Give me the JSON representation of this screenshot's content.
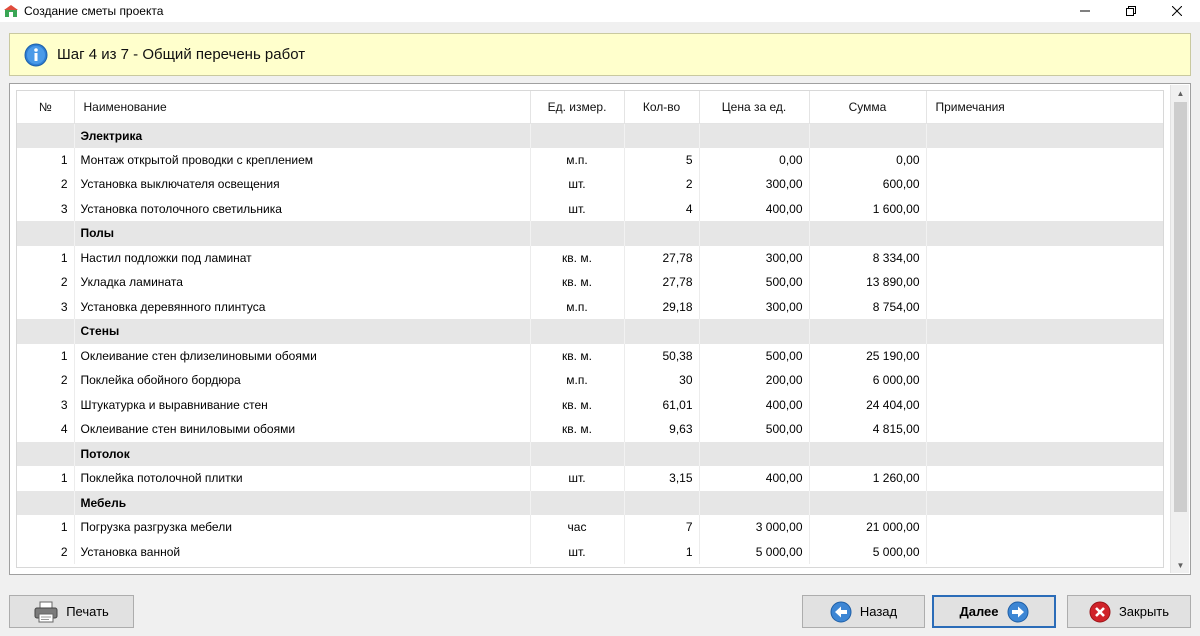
{
  "window": {
    "title": "Создание сметы проекта"
  },
  "step": {
    "text": "Шаг 4 из 7 - Общий перечень работ"
  },
  "table": {
    "columns": [
      "№",
      "Наименование",
      "Ед. измер.",
      "Кол-во",
      "Цена за ед.",
      "Сумма",
      "Примечания"
    ],
    "rows": [
      {
        "type": "category",
        "name": "Электрика"
      },
      {
        "type": "item",
        "no": "1",
        "name": "Монтаж открытой проводки с креплением",
        "unit": "м.п.",
        "qty": "5",
        "price": "0,00",
        "sum": "0,00",
        "note": ""
      },
      {
        "type": "item",
        "no": "2",
        "name": "Установка выключателя освещения",
        "unit": "шт.",
        "qty": "2",
        "price": "300,00",
        "sum": "600,00",
        "note": ""
      },
      {
        "type": "item",
        "no": "3",
        "name": "Установка потолочного светильника",
        "unit": "шт.",
        "qty": "4",
        "price": "400,00",
        "sum": "1 600,00",
        "note": ""
      },
      {
        "type": "category",
        "name": "Полы"
      },
      {
        "type": "item",
        "no": "1",
        "name": "Настил подложки под ламинат",
        "unit": "кв. м.",
        "qty": "27,78",
        "price": "300,00",
        "sum": "8 334,00",
        "note": ""
      },
      {
        "type": "item",
        "no": "2",
        "name": "Укладка ламината",
        "unit": "кв. м.",
        "qty": "27,78",
        "price": "500,00",
        "sum": "13 890,00",
        "note": ""
      },
      {
        "type": "item",
        "no": "3",
        "name": "Установка деревянного плинтуса",
        "unit": "м.п.",
        "qty": "29,18",
        "price": "300,00",
        "sum": "8 754,00",
        "note": ""
      },
      {
        "type": "category",
        "name": "Стены"
      },
      {
        "type": "item",
        "no": "1",
        "name": "Оклеивание стен флизелиновыми обоями",
        "unit": "кв. м.",
        "qty": "50,38",
        "price": "500,00",
        "sum": "25 190,00",
        "note": ""
      },
      {
        "type": "item",
        "no": "2",
        "name": "Поклейка обойного бордюра",
        "unit": "м.п.",
        "qty": "30",
        "price": "200,00",
        "sum": "6 000,00",
        "note": ""
      },
      {
        "type": "item",
        "no": "3",
        "name": "Штукатурка и выравнивание стен",
        "unit": "кв. м.",
        "qty": "61,01",
        "price": "400,00",
        "sum": "24 404,00",
        "note": ""
      },
      {
        "type": "item",
        "no": "4",
        "name": "Оклеивание стен виниловыми обоями",
        "unit": "кв. м.",
        "qty": "9,63",
        "price": "500,00",
        "sum": "4 815,00",
        "note": ""
      },
      {
        "type": "category",
        "name": "Потолок"
      },
      {
        "type": "item",
        "no": "1",
        "name": "Поклейка потолочной плитки",
        "unit": "шт.",
        "qty": "3,15",
        "price": "400,00",
        "sum": "1 260,00",
        "note": ""
      },
      {
        "type": "category",
        "name": "Мебель"
      },
      {
        "type": "item",
        "no": "1",
        "name": "Погрузка разгрузка мебели",
        "unit": "час",
        "qty": "7",
        "price": "3 000,00",
        "sum": "21 000,00",
        "note": ""
      },
      {
        "type": "item",
        "no": "2",
        "name": "Установка ванной",
        "unit": "шт.",
        "qty": "1",
        "price": "5 000,00",
        "sum": "5 000,00",
        "note": ""
      }
    ]
  },
  "buttons": {
    "print": "Печать",
    "back": "Назад",
    "next": "Далее",
    "close": "Закрыть"
  },
  "icons": {
    "print": "printer-icon",
    "back": "arrow-left-icon",
    "next": "arrow-right-icon",
    "close": "close-icon",
    "info": "info-icon"
  },
  "colors": {
    "info_bg": "#ffffcc",
    "category_bg": "#e6e6e6",
    "accent": "#2b6cb8",
    "close_red": "#d0232a"
  }
}
